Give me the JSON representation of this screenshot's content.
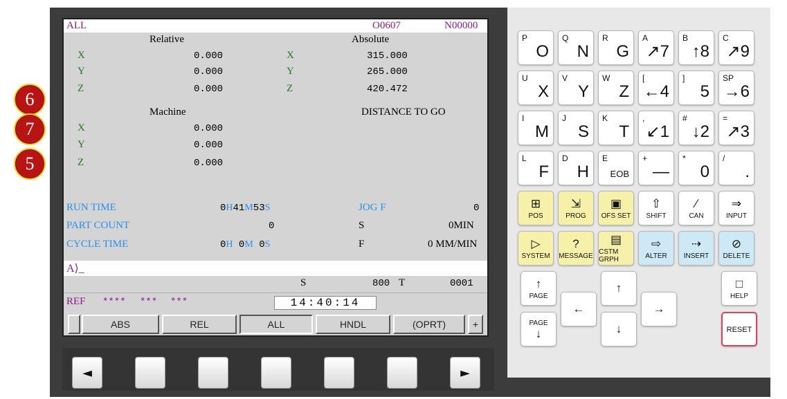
{
  "markers": [
    "6",
    "7",
    "5"
  ],
  "screen": {
    "mode": "ALL",
    "program": "O0607",
    "sequence": "N00000",
    "relative": {
      "title": "Relative",
      "axes": [
        {
          "axis": "X",
          "value": "0.000"
        },
        {
          "axis": "Y",
          "value": "0.000"
        },
        {
          "axis": "Z",
          "value": "0.000"
        }
      ]
    },
    "absolute": {
      "title": "Absolute",
      "axes": [
        {
          "axis": "X",
          "value": "315.000"
        },
        {
          "axis": "Y",
          "value": "265.000"
        },
        {
          "axis": "Z",
          "value": "420.472"
        }
      ]
    },
    "machine": {
      "title": "Machine",
      "axes": [
        {
          "axis": "X",
          "value": "0.000"
        },
        {
          "axis": "Y",
          "value": "0.000"
        },
        {
          "axis": "Z",
          "value": "0.000"
        }
      ]
    },
    "distance_to_go_title": "DISTANCE TO GO",
    "run_time": {
      "label": "RUN TIME",
      "h": "0",
      "h_unit": "H",
      "m": "41",
      "m_unit": "M",
      "s": "53",
      "s_unit": "S"
    },
    "part_count": {
      "label": "PART COUNT",
      "value": "0"
    },
    "cycle_time": {
      "label": "CYCLE TIME",
      "h": "0",
      "h_unit": "H",
      "m": " 0",
      "m_unit": "M",
      "s": " 0",
      "s_unit": "S"
    },
    "jog_f": {
      "label": "JOG F",
      "value": "0"
    },
    "s_row": {
      "label": "S",
      "value": "0MIN"
    },
    "f_row": {
      "label": "F",
      "value": "0 MM/MIN"
    },
    "input_prompt": "A⟩_",
    "spindle_label": "S",
    "spindle_value": "800",
    "tool_label": "T",
    "tool_value": "0001",
    "status": {
      "ref": "REF",
      "s1": "****",
      "s2": "***",
      "s3": "***"
    },
    "clock": "14:40:14",
    "softkeys": [
      "",
      "ABS",
      "REL",
      "ALL",
      "HNDL",
      "(OPRT)",
      "+"
    ]
  },
  "hw_softkeys": {
    "left": "◄",
    "right": "►"
  },
  "keypad": {
    "letter_keys": [
      {
        "small": "P",
        "large": "O"
      },
      {
        "small": "Q",
        "large": "N"
      },
      {
        "small": "R",
        "large": "G"
      },
      {
        "small": "A",
        "large": "↗7"
      },
      {
        "small": "B",
        "large": "↑8"
      },
      {
        "small": "C",
        "large": "↗9"
      },
      {
        "small": "U",
        "large": "X"
      },
      {
        "small": "V",
        "large": "Y"
      },
      {
        "small": "W",
        "large": "Z"
      },
      {
        "small": "[",
        "large": "←4"
      },
      {
        "small": "]",
        "large": "5"
      },
      {
        "small": "SP",
        "large": "→6"
      },
      {
        "small": "I",
        "large": "M"
      },
      {
        "small": "J",
        "large": "S"
      },
      {
        "small": "K",
        "large": "T"
      },
      {
        "small": ",",
        "large": "↙1"
      },
      {
        "small": "#",
        "large": "↓2"
      },
      {
        "small": "=",
        "large": "↗3"
      },
      {
        "small": "L",
        "large": "F"
      },
      {
        "small": "D",
        "large": "H"
      },
      {
        "small": "E",
        "large": "EOB"
      },
      {
        "small": "+",
        "large": "—"
      },
      {
        "small": "*",
        "large": "0"
      },
      {
        "small": "/",
        "large": "."
      }
    ],
    "function_keys": [
      {
        "icon": "⊞",
        "label": "POS",
        "color": "#f7f0a8"
      },
      {
        "icon": "⇲",
        "label": "PROG",
        "color": "#f7f0a8"
      },
      {
        "icon": "▣",
        "label": "OFS SET",
        "color": "#f7f0a8"
      },
      {
        "icon": "⇧",
        "label": "SHIFT",
        "color": "#ffffff"
      },
      {
        "icon": "∕",
        "label": "CAN",
        "color": "#ffffff"
      },
      {
        "icon": "⇒",
        "label": "INPUT",
        "color": "#ffffff"
      },
      {
        "icon": "▷",
        "label": "SYSTEM",
        "color": "#f7f0a8"
      },
      {
        "icon": "?",
        "label": "MESSAGE",
        "color": "#f7f0a8"
      },
      {
        "icon": "▤",
        "label": "CSTM GRPH",
        "color": "#f7f0a8"
      },
      {
        "icon": "⇨",
        "label": "ALTER",
        "color": "#cde9f5"
      },
      {
        "icon": "⇢",
        "label": "INSERT",
        "color": "#cde9f5"
      },
      {
        "icon": "⊘",
        "label": "DELETE",
        "color": "#cde9f5"
      }
    ],
    "page_up": {
      "arrow": "↑",
      "label": "PAGE"
    },
    "page_down": {
      "arrow": "↓",
      "label": "PAGE"
    },
    "cursor_up": "↑",
    "cursor_down": "↓",
    "cursor_left": "←",
    "cursor_right": "→",
    "help": {
      "icon": "□",
      "label": "HELP"
    },
    "reset": {
      "label": "RESET"
    }
  }
}
